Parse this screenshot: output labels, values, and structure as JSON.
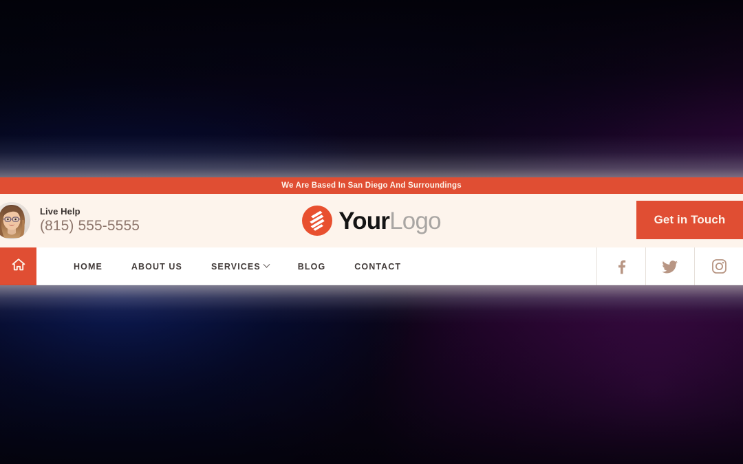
{
  "announcement": {
    "text": "We Are Based In San Diego And Surroundings",
    "background_color": "#e04e33",
    "text_color": "#fdf3ea"
  },
  "header": {
    "background_color": "#fdf4ec",
    "contact": {
      "avatar_name": "woman-with-glasses-avatar",
      "label": "Live Help",
      "phone": "(815) 555-5555",
      "label_color": "#3a3330",
      "phone_color": "#8d756b"
    },
    "logo": {
      "mark_name": "orange-circle-s-logo-icon",
      "mark_color": "#e8502f",
      "primary_text": "Your",
      "secondary_text": "Logo",
      "primary_color": "#141414",
      "secondary_color": "#a9a6a3"
    },
    "cta": {
      "label": "Get in Touch",
      "background_color": "#e04e33",
      "text_color": "#fdf3ea"
    }
  },
  "navbar": {
    "background_color": "#ffffff",
    "home_button": {
      "icon": "home-icon",
      "background_color": "#e04e33",
      "icon_color": "#fdf3ea"
    },
    "links": [
      {
        "label": "HOME",
        "has_dropdown": false
      },
      {
        "label": "ABOUT US",
        "has_dropdown": false
      },
      {
        "label": "SERVICES",
        "has_dropdown": true
      },
      {
        "label": "BLOG",
        "has_dropdown": false
      },
      {
        "label": "CONTACT",
        "has_dropdown": false
      }
    ],
    "link_color": "#413a38",
    "social": [
      {
        "name": "facebook-icon",
        "label": "Facebook"
      },
      {
        "name": "twitter-icon",
        "label": "Twitter"
      },
      {
        "name": "instagram-icon",
        "label": "Instagram"
      }
    ],
    "social_icon_color": "#b89684"
  },
  "background": {
    "description": "dark gradient",
    "left_color": "#0c1a52",
    "right_color": "#3b0a44",
    "base_color": "#050308"
  }
}
